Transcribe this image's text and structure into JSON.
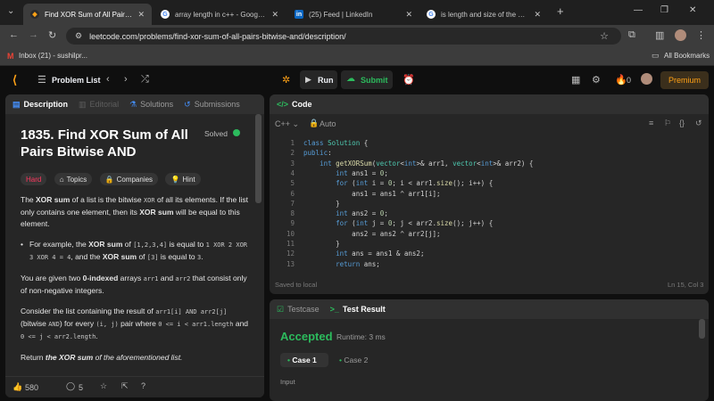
{
  "browser": {
    "tabs": [
      {
        "title": "Find XOR Sum of All Pairs Bitwis",
        "icon": "leetcode-icon",
        "active": true
      },
      {
        "title": "array length in c++ - Google Se",
        "icon": "google-icon",
        "active": false
      },
      {
        "title": "(25) Feed | LinkedIn",
        "icon": "linkedin-icon",
        "active": false
      },
      {
        "title": "is length and size of the array s",
        "icon": "google-icon",
        "active": false
      }
    ],
    "url": "leetcode.com/problems/find-xor-sum-of-all-pairs-bitwise-and/description/",
    "bookmarks": {
      "gmail": "Inbox (21) - sushilpr...",
      "all": "All Bookmarks"
    }
  },
  "header": {
    "problem_list": "Problem List",
    "run": "Run",
    "submit": "Submit",
    "fire_count": "0",
    "premium": "Premium"
  },
  "description_panel": {
    "tabs": [
      "Description",
      "Editorial",
      "Solutions",
      "Submissions"
    ],
    "title": "1835. Find XOR Sum of All Pairs Bitwise AND",
    "solved": "Solved",
    "chips": {
      "difficulty": "Hard",
      "topics": "Topics",
      "companies": "Companies",
      "hint": "Hint"
    },
    "p1": {
      "a": "The ",
      "b": "XOR sum",
      "c": " of a list is the bitwise ",
      "d": "XOR",
      "e": " of all its elements. If the list only contains one element, then its ",
      "f": "XOR sum",
      "g": " will be equal to this element."
    },
    "bullet": {
      "a": "For example, the ",
      "b": "XOR sum",
      "c": " of ",
      "d": "[1,2,3,4]",
      "e": " is equal to ",
      "f": "1 XOR 2 XOR 3 XOR 4 = 4",
      "g": ", and the ",
      "h": "XOR sum",
      "i": " of ",
      "j": "[3]",
      "k": " is equal to ",
      "l": "3",
      "m": "."
    },
    "p2": {
      "a": "You are given two ",
      "b": "0-indexed",
      "c": " arrays ",
      "d": "arr1",
      "e": " and ",
      "f": "arr2",
      "g": " that consist only of non-negative integers."
    },
    "p3": {
      "a": "Consider the list containing the result of ",
      "b": "arr1[i] AND arr2[j]",
      "c": " (bitwise ",
      "d": "AND",
      "e": ") for every ",
      "f": "(i, j)",
      "g": " pair where ",
      "h": "0 <= i < arr1.length",
      "i": " and ",
      "j": "0 <= j < arr2.length",
      "k": "."
    },
    "p4": {
      "a": "Return ",
      "b": "the XOR sum",
      "c": " of the aforementioned list."
    },
    "footer": {
      "likes": "580",
      "comments": "5"
    }
  },
  "code_panel": {
    "tab": "Code",
    "language": "C++",
    "mode": "Auto",
    "status_left": "Saved to local",
    "status_right": "Ln 15, Col 3",
    "lines": [
      "class Solution {",
      "public:",
      "    int getXORSum(vector<int>& arr1, vector<int>& arr2) {",
      "        int ans1 = 0;",
      "        for (int i = 0; i < arr1.size(); i++) {",
      "            ans1 = ans1 ^ arr1[i];",
      "        }",
      "        int ans2 = 0;",
      "        for (int j = 0; j < arr2.size(); j++) {",
      "            ans2 = ans2 ^ arr2[j];",
      "        }",
      "        int ans = ans1 & ans2;",
      "        return ans;"
    ]
  },
  "result_panel": {
    "tabs": [
      "Testcase",
      "Test Result"
    ],
    "verdict": "Accepted",
    "runtime": "Runtime: 3 ms",
    "cases": [
      "Case 1",
      "Case 2"
    ],
    "input_label": "Input"
  },
  "colors": {
    "accepted": "#2cbb5d",
    "hard": "#ff375f",
    "premium": "#ffa116",
    "link": "#448df6"
  }
}
